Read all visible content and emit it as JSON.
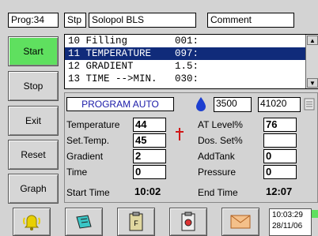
{
  "header": {
    "prog": "Prog:34",
    "stp": "Stp",
    "recipe": "Solopol BLS",
    "comment": "Comment"
  },
  "sidebar": {
    "buttons": [
      {
        "label": "Start"
      },
      {
        "label": "Stop"
      },
      {
        "label": "Exit"
      },
      {
        "label": "Reset"
      },
      {
        "label": "Graph"
      }
    ]
  },
  "steps": [
    "10 Filling        001:",
    "11 TEMPERATURE    097:",
    "12 GRADIENT       1.5:",
    "13 TIME -->MIN.   030:"
  ],
  "status": {
    "mode": "PROGRAM AUTO",
    "level_a": "3500",
    "level_b": "41020"
  },
  "params_left": [
    {
      "label": "Temperature",
      "value": "44"
    },
    {
      "label": "Set.Temp.",
      "value": "45"
    },
    {
      "label": "Gradient",
      "value": "2"
    },
    {
      "label": "Time",
      "value": "0"
    }
  ],
  "params_right": [
    {
      "label": "AT Level%",
      "value": "76"
    },
    {
      "label": "Dos. Set%",
      "value": ""
    },
    {
      "label": "AddTank",
      "value": "0"
    },
    {
      "label": "Pressure",
      "value": "0"
    }
  ],
  "times": {
    "start_label": "Start Time",
    "start_value": "10:02",
    "end_label": "End Time",
    "end_value": "12:07"
  },
  "clock": {
    "time": "10:03:29",
    "date": "28/11/06"
  },
  "colors": {
    "start_active": "#5fe05f",
    "selection": "#102b7a",
    "mode_text": "#1a1aa8",
    "alarm_icon": "#e8d000"
  }
}
